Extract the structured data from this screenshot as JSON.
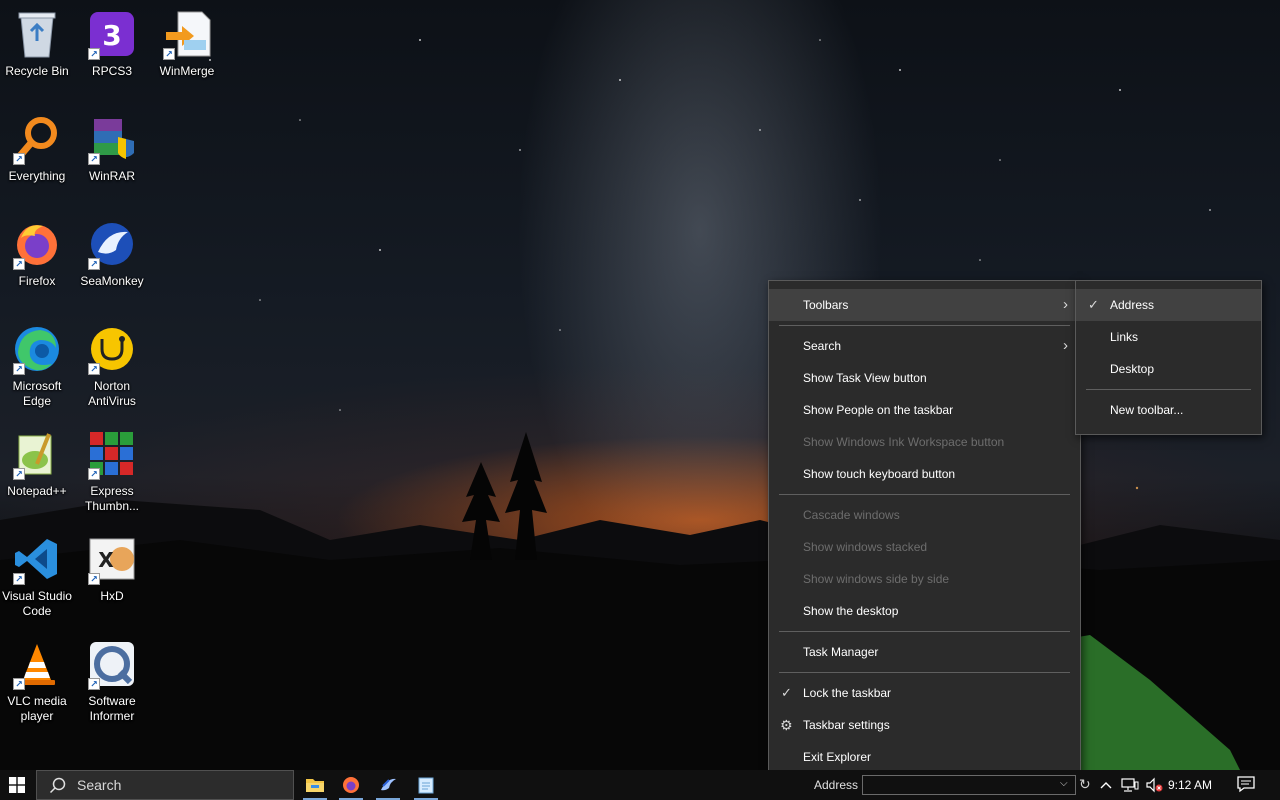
{
  "desktop": {
    "icons": [
      {
        "label": "Recycle Bin",
        "icon": "recycle-bin-icon"
      },
      {
        "label": "RPCS3",
        "icon": "rpcs3-icon"
      },
      {
        "label": "WinMerge",
        "icon": "winmerge-icon"
      },
      {
        "label": "Everything",
        "icon": "everything-search-icon"
      },
      {
        "label": "WinRAR",
        "icon": "winrar-icon"
      },
      {
        "label": "Firefox",
        "icon": "firefox-icon"
      },
      {
        "label": "SeaMonkey",
        "icon": "seamonkey-icon"
      },
      {
        "label": "Microsoft Edge",
        "icon": "edge-icon"
      },
      {
        "label": "Norton AntiVirus",
        "icon": "norton-icon"
      },
      {
        "label": "Notepad++",
        "icon": "notepadpp-icon"
      },
      {
        "label": "Express Thumbn...",
        "icon": "express-thumbnail-icon"
      },
      {
        "label": "Visual Studio Code",
        "icon": "vscode-icon"
      },
      {
        "label": "HxD",
        "icon": "hxd-icon"
      },
      {
        "label": "VLC media player",
        "icon": "vlc-icon"
      },
      {
        "label": "Software Informer",
        "icon": "software-informer-icon"
      }
    ]
  },
  "context_menu": {
    "items": [
      {
        "label": "Toolbars",
        "submenu": true,
        "highlighted": true
      },
      {
        "label": "Search",
        "submenu": true
      },
      {
        "label": "Show Task View button"
      },
      {
        "label": "Show People on the taskbar"
      },
      {
        "label": "Show Windows Ink Workspace button",
        "disabled": true
      },
      {
        "label": "Show touch keyboard button"
      },
      {
        "label": "Cascade windows",
        "disabled": true
      },
      {
        "label": "Show windows stacked",
        "disabled": true
      },
      {
        "label": "Show windows side by side",
        "disabled": true
      },
      {
        "label": "Show the desktop"
      },
      {
        "label": "Task Manager"
      },
      {
        "label": "Lock the taskbar",
        "checked": true
      },
      {
        "label": "Taskbar settings",
        "icon": "gear-icon"
      },
      {
        "label": "Exit Explorer"
      }
    ]
  },
  "toolbars_submenu": {
    "items": [
      {
        "label": "Address",
        "checked": true,
        "highlighted": true
      },
      {
        "label": "Links"
      },
      {
        "label": "Desktop"
      },
      {
        "label": "New toolbar..."
      }
    ]
  },
  "taskbar": {
    "search_placeholder": "Search",
    "pinned_apps": [
      "file-explorer-icon",
      "firefox-icon",
      "seamonkey-icon",
      "notepad-icon"
    ],
    "address_toolbar_label": "Address",
    "address_value": "",
    "clock": "9:12 AM",
    "tray_icons": [
      "chevron-up-icon",
      "network-icon",
      "volume-muted-icon",
      "action-center-icon"
    ]
  },
  "colors": {
    "menu_bg": "#2b2b2b",
    "menu_highlight": "#414141",
    "menu_disabled_text": "#6d6d6d",
    "taskbar_bg": "#101010"
  }
}
